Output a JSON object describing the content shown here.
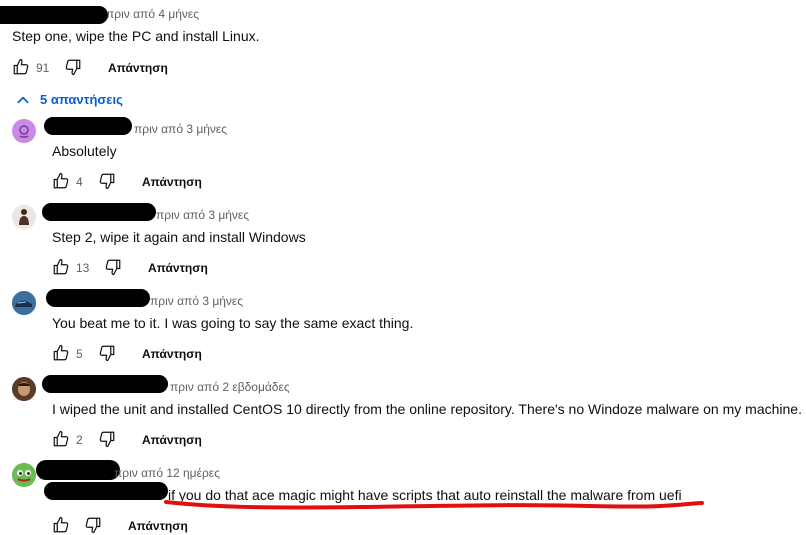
{
  "top_comment": {
    "time": "πριν από 4 μήνες",
    "text": "Step one, wipe the PC and install Linux.",
    "likes": "91",
    "reply_label": "Απάντηση"
  },
  "replies_toggle": {
    "label": "5 απαντήσεις",
    "icon": "chevron-up-icon"
  },
  "replies": [
    {
      "time": "πριν από 3 μήνες",
      "text": "Absolutely",
      "likes": "4",
      "reply_label": "Απάντηση"
    },
    {
      "time": "πριν από 3 μήνες",
      "text": "Step 2, wipe it again and install Windows",
      "likes": "13",
      "reply_label": "Απάντηση"
    },
    {
      "time": "πριν από 3 μήνες",
      "text": "You beat me to it. I was going to say the same exact thing.",
      "likes": "5",
      "reply_label": "Απάντηση"
    },
    {
      "time": "πριν από 2 εβδομάδες",
      "text": "I wiped the unit and installed CentOS 10 directly from the online repository.  There's no Windoze malware on my machine.",
      "likes": "2",
      "reply_label": "Απάντηση"
    },
    {
      "time": "πριν από 12 ημέρες",
      "text": "if you do that ace magic might have scripts that auto reinstall the malware from uefi",
      "likes": "",
      "reply_label": "Απάντηση"
    }
  ],
  "colors": {
    "link_blue": "#065fd4",
    "annotation_red": "#e01010",
    "redaction": "#000000"
  }
}
